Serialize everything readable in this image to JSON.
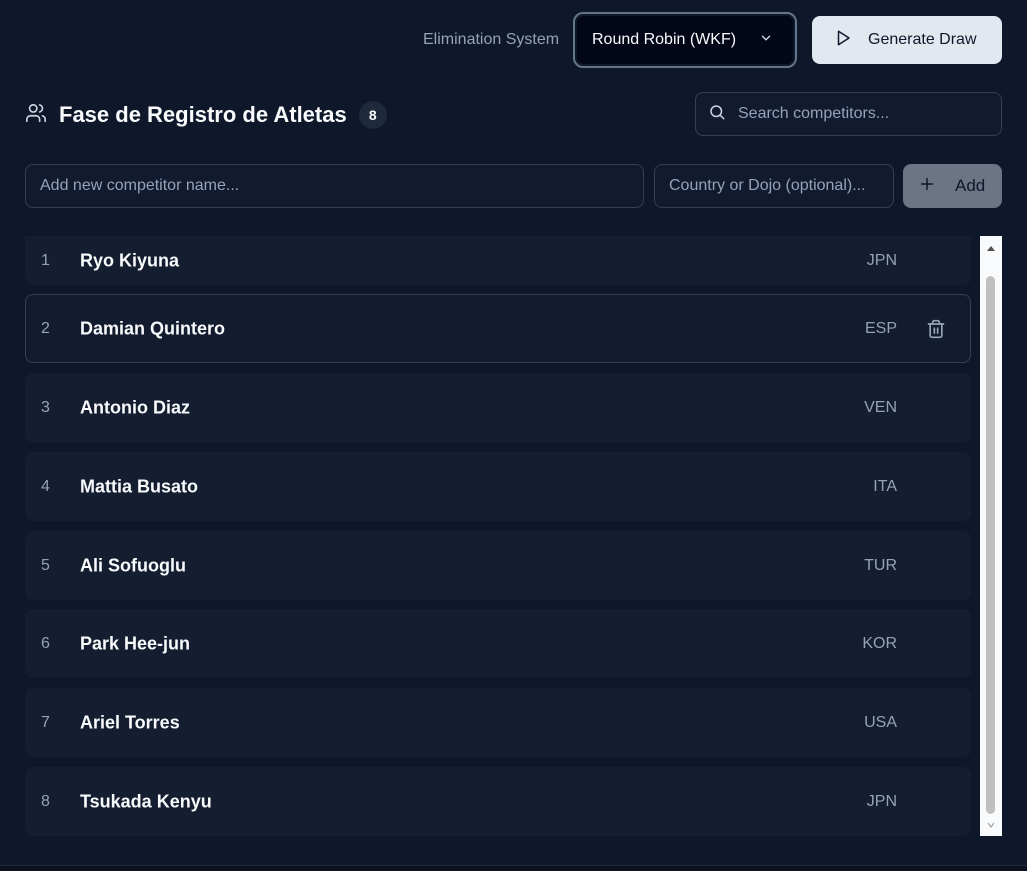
{
  "toolbar": {
    "elimination_label": "Elimination System",
    "elimination_value": "Round Robin (WKF)",
    "generate_label": "Generate Draw"
  },
  "header": {
    "title": "Fase de Registro de Atletas",
    "count": "8",
    "search_placeholder": "Search competitors..."
  },
  "add_form": {
    "name_placeholder": "Add new competitor name...",
    "country_placeholder": "Country or Dojo (optional)...",
    "add_label": "Add"
  },
  "competitors": [
    {
      "num": "1",
      "name": "Ryo Kiyuna",
      "country": "JPN"
    },
    {
      "num": "2",
      "name": "Damian Quintero",
      "country": "ESP"
    },
    {
      "num": "3",
      "name": "Antonio Diaz",
      "country": "VEN"
    },
    {
      "num": "4",
      "name": "Mattia Busato",
      "country": "ITA"
    },
    {
      "num": "5",
      "name": "Ali Sofuoglu",
      "country": "TUR"
    },
    {
      "num": "6",
      "name": "Park Hee-jun",
      "country": "KOR"
    },
    {
      "num": "7",
      "name": "Ariel Torres",
      "country": "USA"
    },
    {
      "num": "8",
      "name": "Tsukada Kenyu",
      "country": "JPN"
    }
  ],
  "icons": {
    "users": "users-icon",
    "search": "search-icon",
    "play": "play-icon",
    "plus": "plus-icon",
    "chevron": "chevron-down-icon",
    "trash": "trash-icon"
  },
  "colors": {
    "background": "#0f172a",
    "row": "#151e31",
    "muted": "#94a3b8",
    "primary_button": "#e2e8f0"
  }
}
